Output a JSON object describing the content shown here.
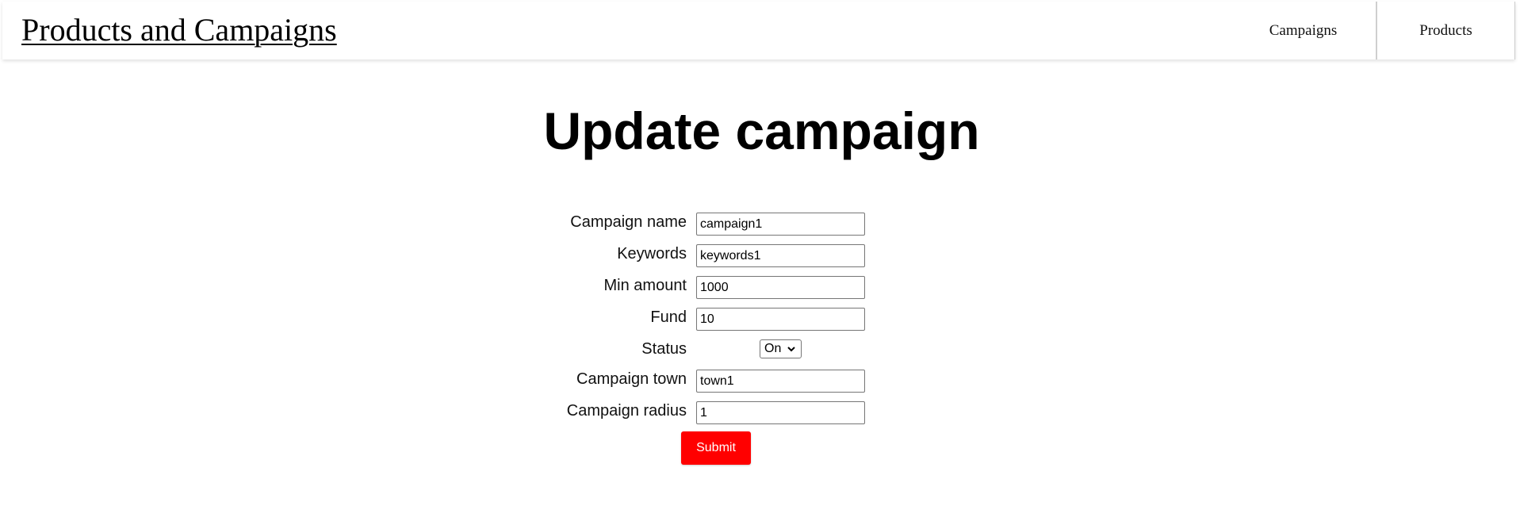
{
  "header": {
    "brand": "Products and Campaigns",
    "nav": [
      "Campaigns",
      "Products"
    ]
  },
  "page_title": "Update campaign",
  "form": {
    "fields": [
      {
        "label": "Campaign name",
        "value": "campaign1"
      },
      {
        "label": "Keywords",
        "value": "keywords1"
      },
      {
        "label": "Min amount",
        "value": "1000"
      },
      {
        "label": "Fund",
        "value": "10"
      },
      {
        "label": "Status",
        "value": "On"
      },
      {
        "label": "Campaign town",
        "value": "town1"
      },
      {
        "label": "Campaign radius",
        "value": "1"
      }
    ],
    "submit_label": "Submit"
  },
  "colors": {
    "submit_bg": "#ff0000",
    "submit_text": "#ffffff"
  }
}
